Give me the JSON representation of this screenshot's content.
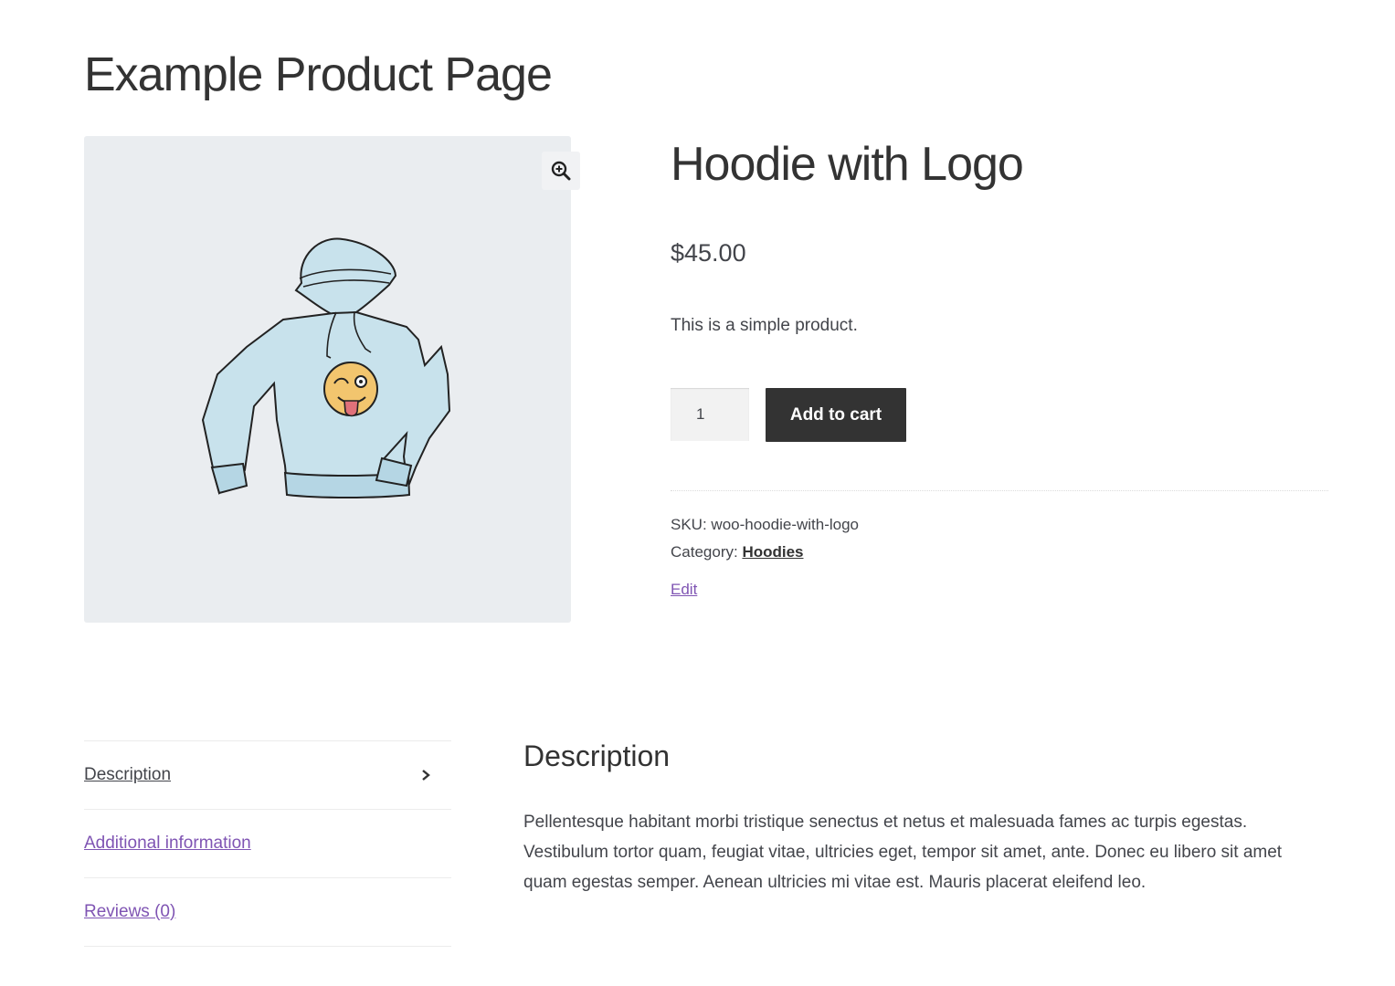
{
  "page": {
    "title": "Example Product Page"
  },
  "product": {
    "name": "Hoodie with Logo",
    "price": "$45.00",
    "short_description": "This is a simple product.",
    "quantity": "1",
    "add_to_cart_label": "Add to cart",
    "sku_label": "SKU:",
    "sku_value": "woo-hoodie-with-logo",
    "category_label": "Category:",
    "category_value": "Hoodies",
    "edit_label": "Edit",
    "image_icon": "hoodie-illustration",
    "zoom_icon": "zoom-in-icon"
  },
  "tabs": [
    {
      "label": "Description",
      "active": true
    },
    {
      "label": "Additional information",
      "active": false
    },
    {
      "label": "Reviews (0)",
      "active": false
    }
  ],
  "panel": {
    "heading": "Description",
    "text": "Pellentesque habitant morbi tristique senectus et netus et malesuada fames ac turpis egestas. Vestibulum tortor quam, feugiat vitae, ultricies eget, tempor sit amet, ante. Donec eu libero sit amet quam egestas semper. Aenean ultricies mi vitae est. Mauris placerat eleifend leo."
  },
  "colors": {
    "button_bg": "#333333",
    "link": "#7f54b3",
    "gallery_bg": "#eaedf0",
    "hoodie": "#c8e2ec",
    "emoji": "#f2c56e"
  }
}
